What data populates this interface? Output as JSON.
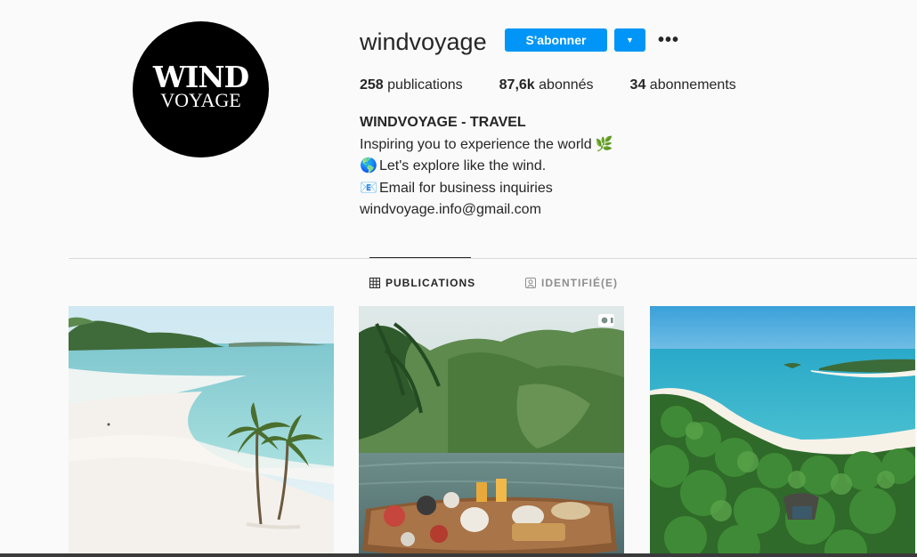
{
  "profile": {
    "avatar_line1": "WIND",
    "avatar_line2": "VOYAGE",
    "username": "windvoyage",
    "follow_label": "S'abonner",
    "dropdown_icon": "▼",
    "more_icon": "•••"
  },
  "stats": {
    "posts_count": "258",
    "posts_label": "publications",
    "followers_count": "87,6k",
    "followers_label": "abonnés",
    "following_count": "34",
    "following_label": "abonnements"
  },
  "bio": {
    "name": "WINDVOYAGE - TRAVEL",
    "line1": "Inspiring you to experience the world",
    "line1_emoji": "🌿",
    "line2_emoji": "🌎",
    "line2": "Let's explore like the wind.",
    "line3_emoji": "📧",
    "line3": "Email for business inquiries",
    "line4": "windvoyage.info@gmail.com"
  },
  "tabs": {
    "publications": "PUBLICATIONS",
    "tagged": "IDENTIFIÉ(E)"
  },
  "posts": [
    {
      "icon": "image",
      "description": "beach-with-palm-trees"
    },
    {
      "icon": "video-icon",
      "description": "floating-breakfast-infinity-pool"
    },
    {
      "icon": "image",
      "description": "tropical-island-aerial"
    }
  ],
  "colors": {
    "accent": "#0095f6",
    "background": "#fafafa",
    "text": "#262626",
    "muted": "#8e8e8e",
    "divider": "#dbdbdb"
  }
}
